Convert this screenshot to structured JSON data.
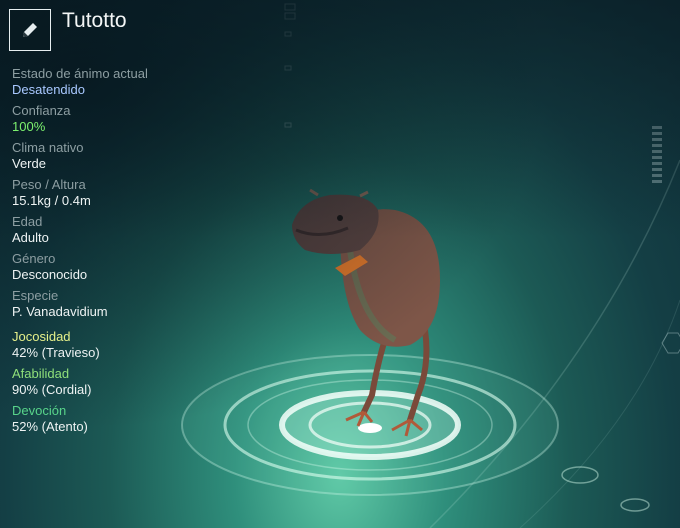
{
  "header": {
    "creature_name": "Tutotto",
    "edit_icon": "pencil-icon"
  },
  "stats": [
    {
      "key": "mood",
      "label": "Estado de ánimo actual",
      "value": "Desatendido",
      "value_color": "#a9c8ff"
    },
    {
      "key": "trust",
      "label": "Confianza",
      "value": "100%",
      "value_color": "#7cf06e"
    },
    {
      "key": "climate",
      "label": "Clima nativo",
      "value": "Verde",
      "value_color": "#eef3f3"
    },
    {
      "key": "weight",
      "label": "Peso / Altura",
      "value": "15.1kg / 0.4m",
      "value_color": "#eef3f3"
    },
    {
      "key": "age",
      "label": "Edad",
      "value": "Adulto",
      "value_color": "#eef3f3"
    },
    {
      "key": "gender",
      "label": "Género",
      "value": "Desconocido",
      "value_color": "#eef3f3"
    },
    {
      "key": "species",
      "label": "Especie",
      "value": "P. Vanadavidium",
      "value_color": "#eef3f3"
    }
  ],
  "traits": [
    {
      "key": "playfulness",
      "label": "Jocosidad",
      "value": "42% (Travieso)",
      "label_color": "#e6f08a"
    },
    {
      "key": "friendliness",
      "label": "Afabilidad",
      "value": "90% (Cordial)",
      "label_color": "#8fe07a"
    },
    {
      "key": "devotion",
      "label": "Devoción",
      "value": "52% (Atento)",
      "label_color": "#58d48a"
    }
  ],
  "colors": {
    "accent": "#5fc9a6",
    "background_dark": "#0f2f38"
  }
}
